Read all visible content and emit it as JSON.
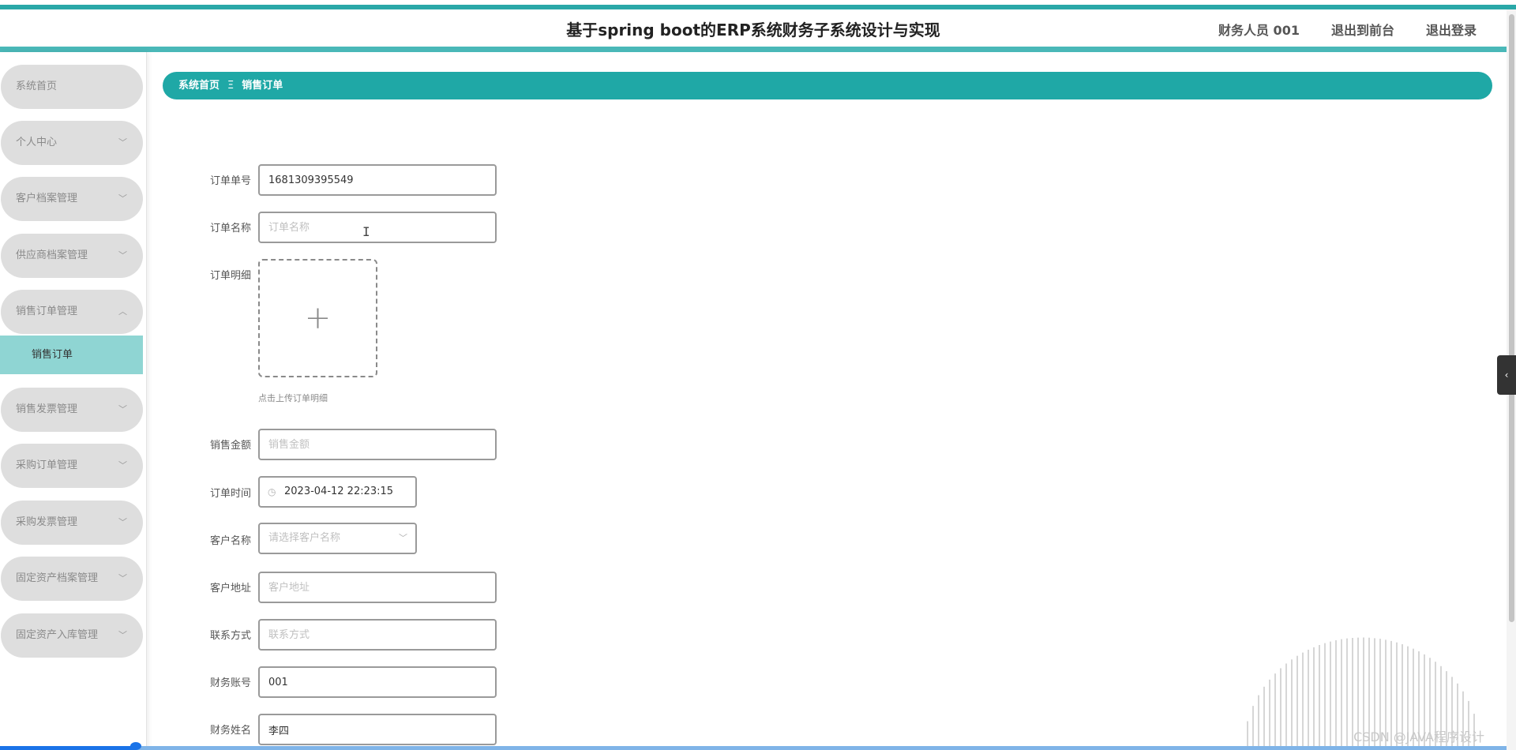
{
  "header": {
    "title": "基于spring boot的ERP系统财务子系统设计与实现",
    "user": "财务人员 001",
    "exit_front": "退出到前台",
    "logout": "退出登录"
  },
  "sidebar": {
    "items": [
      {
        "label": "系统首页",
        "has_chevron": false
      },
      {
        "label": "个人中心",
        "has_chevron": true
      },
      {
        "label": "客户档案管理",
        "has_chevron": true
      },
      {
        "label": "供应商档案管理",
        "has_chevron": true
      },
      {
        "label": "销售订单管理",
        "has_chevron": true,
        "expanded": true
      },
      {
        "label": "销售发票管理",
        "has_chevron": true
      },
      {
        "label": "采购订单管理",
        "has_chevron": true
      },
      {
        "label": "采购发票管理",
        "has_chevron": true
      },
      {
        "label": "固定资产档案管理",
        "has_chevron": true
      },
      {
        "label": "固定资产入库管理",
        "has_chevron": true
      }
    ],
    "active_sub": "销售订单",
    "chevron_down": "﹀",
    "chevron_up": "︿"
  },
  "breadcrumb": {
    "home": "系统首页",
    "separator": "Ξ",
    "current": "销售订单"
  },
  "form": {
    "order_no": {
      "label": "订单单号",
      "value": "1681309395549"
    },
    "order_name": {
      "label": "订单名称",
      "placeholder": "订单名称"
    },
    "order_detail": {
      "label": "订单明细",
      "upload_hint": "点击上传订单明细",
      "plus": "+"
    },
    "sale_amount": {
      "label": "销售金额",
      "placeholder": "销售金额"
    },
    "order_time": {
      "label": "订单时间",
      "value": "2023-04-12 22:23:15"
    },
    "customer_name": {
      "label": "客户名称",
      "placeholder": "请选择客户名称"
    },
    "customer_address": {
      "label": "客户地址",
      "placeholder": "客户地址"
    },
    "contact": {
      "label": "联系方式",
      "placeholder": "联系方式"
    },
    "finance_account": {
      "label": "财务账号",
      "value": "001"
    },
    "finance_name": {
      "label": "财务姓名",
      "value": "李四"
    }
  },
  "icons": {
    "clock": "clock-icon",
    "select_arrow": "chevron-down-icon",
    "side_toggle": "chevron-left-icon"
  },
  "text_cursor": "I",
  "side_toggle_glyph": "‹",
  "watermark": "CSDN @JAVA程序设计",
  "progress": 0.09,
  "colors": {
    "accent": "#1fa8a6",
    "active_sub_bg": "#8fd5d3",
    "menu_bg": "#dedede"
  }
}
